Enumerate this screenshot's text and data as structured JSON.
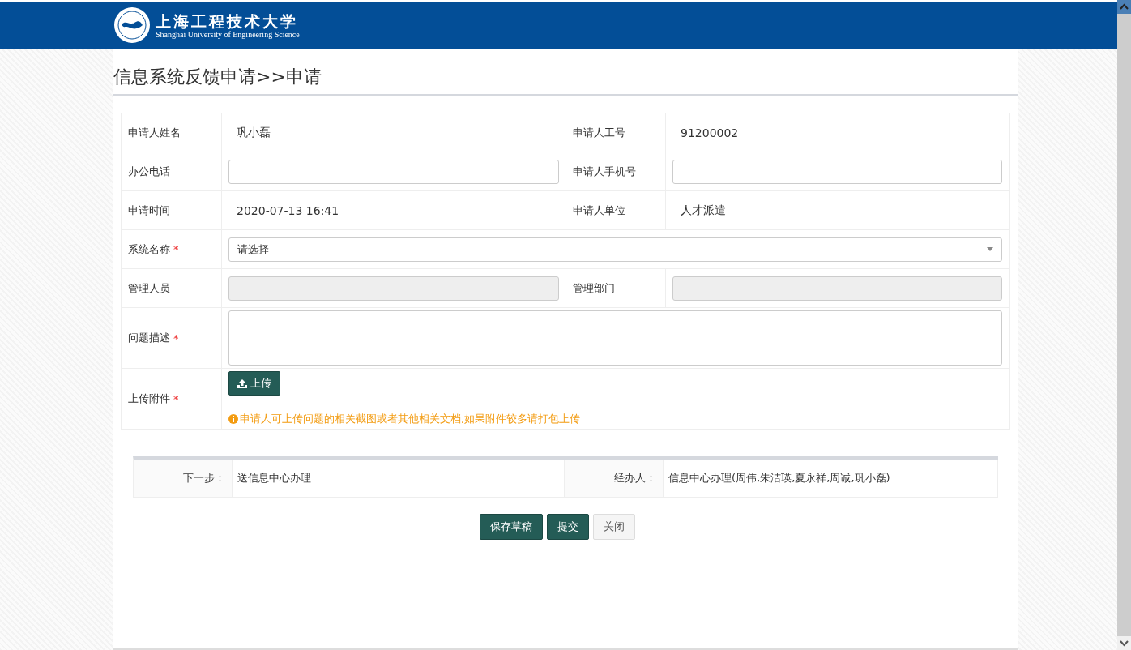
{
  "header": {
    "logo_cn": "上海工程技术大学",
    "logo_en": "Shanghai University of Engineering Science"
  },
  "page_title": "信息系统反馈申请>>申请",
  "form": {
    "rows": [
      {
        "kind": "pair",
        "cells": [
          {
            "label": "申请人姓名",
            "kind": "text",
            "value": "巩小磊"
          },
          {
            "label": "申请人工号",
            "kind": "text",
            "value": "91200002"
          }
        ]
      },
      {
        "kind": "pair",
        "cells": [
          {
            "label": "办公电话",
            "kind": "input",
            "disabled": false
          },
          {
            "label": "申请人手机号",
            "kind": "input",
            "disabled": false
          }
        ]
      },
      {
        "kind": "pair",
        "cells": [
          {
            "label": "申请时间",
            "kind": "text",
            "value": "2020-07-13 16:41"
          },
          {
            "label": "申请人单位",
            "kind": "text",
            "value": "人才派遣"
          }
        ]
      },
      {
        "kind": "select",
        "label": "系统名称",
        "required_mark": "*",
        "value": "请选择"
      },
      {
        "kind": "pair",
        "cells": [
          {
            "label": "管理人员",
            "kind": "input",
            "disabled": true
          },
          {
            "label": "管理部门",
            "kind": "input",
            "disabled": true
          }
        ]
      },
      {
        "kind": "textarea",
        "label": "问题描述",
        "required_mark": "*"
      },
      {
        "kind": "upload",
        "label": "上传附件",
        "required_mark": "*",
        "button": "上传",
        "hint": "申请人可上传问题的相关截图或者其他相关文档,如果附件较多请打包上传"
      }
    ]
  },
  "flow": {
    "next_label": "下一步：",
    "next_value": "送信息中心办理",
    "handler_label": "经办人：",
    "handler_value": "信息中心办理(周伟,朱洁瑛,夏永祥,周诚,巩小磊)"
  },
  "buttons": [
    {
      "label": "保存草稿",
      "kind": "primary"
    },
    {
      "label": "提交",
      "kind": "primary"
    },
    {
      "label": "关闭",
      "kind": "default"
    }
  ]
}
